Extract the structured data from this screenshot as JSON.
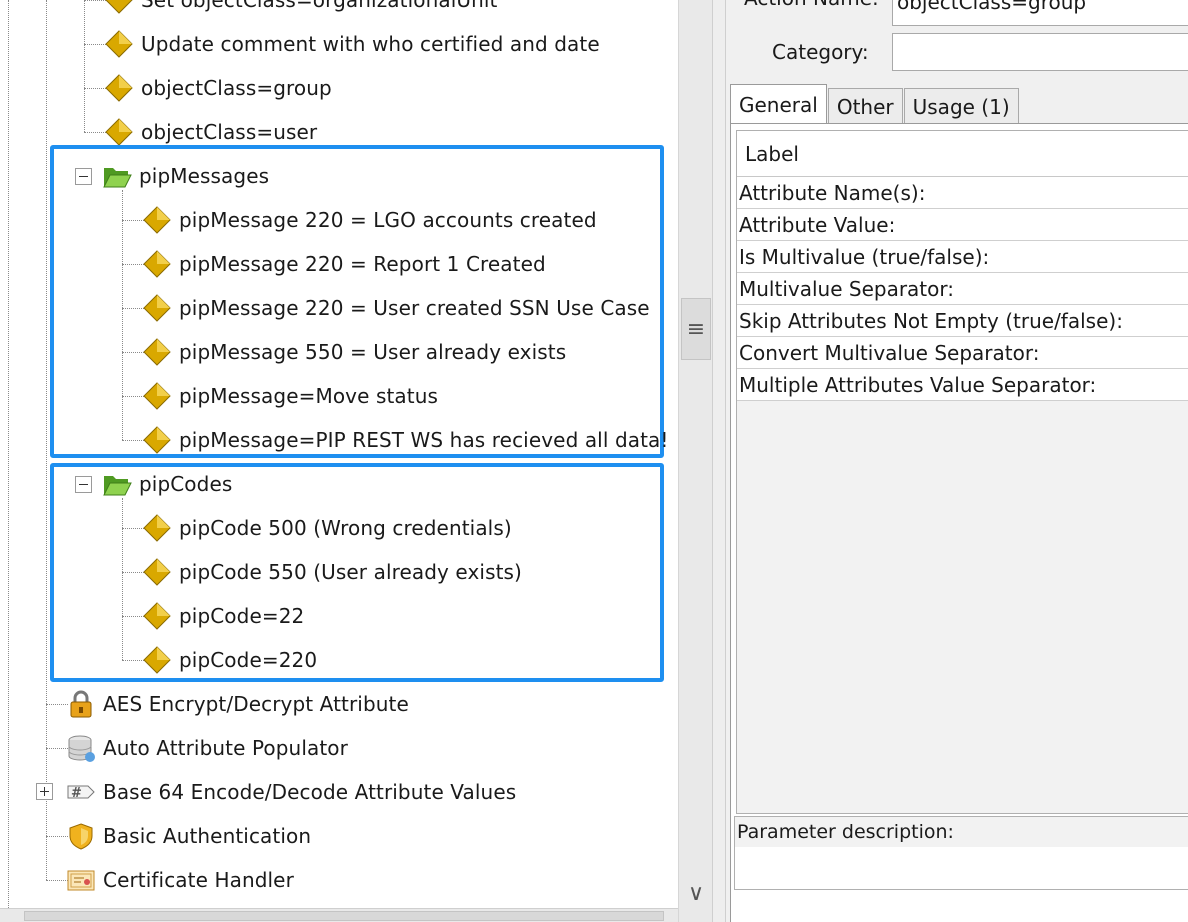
{
  "tree": {
    "top_items": [
      {
        "label": "Set objectClass=organizationalUnit",
        "icon": "action-diamond-icon"
      },
      {
        "label": "Update comment with who certified and date",
        "icon": "action-diamond-icon"
      },
      {
        "label": "objectClass=group",
        "icon": "action-diamond-icon"
      },
      {
        "label": "objectClass=user",
        "icon": "action-diamond-icon"
      }
    ],
    "pipMessages": {
      "label": "pipMessages",
      "items": [
        "pipMessage 220 = LGO accounts created",
        "pipMessage 220 = Report 1 Created",
        "pipMessage 220 = User created SSN Use Case",
        "pipMessage 550 = User already exists",
        "pipMessage=Move status",
        "pipMessage=PIP REST WS has recieved all data!"
      ]
    },
    "pipCodes": {
      "label": "pipCodes",
      "items": [
        "pipCode 500 (Wrong credentials)",
        "pipCode 550 (User already exists)",
        "pipCode=22",
        "pipCode=220"
      ]
    },
    "handlers": [
      {
        "label": "AES Encrypt/Decrypt Attribute",
        "icon": "lock-icon"
      },
      {
        "label": "Auto Attribute Populator",
        "icon": "database-icon"
      },
      {
        "label": "Base 64 Encode/Decode Attribute Values",
        "icon": "hash-tag-icon"
      },
      {
        "label": "Basic Authentication",
        "icon": "shield-icon"
      },
      {
        "label": "Certificate Handler",
        "icon": "certificate-icon"
      }
    ],
    "colors": {
      "highlight": "#1e8ff0",
      "folder": "#6fbf3a",
      "diamond": "#d9a800"
    }
  },
  "form": {
    "action_name_label": "Action Name:",
    "action_name_value": "objectClass=group",
    "category_label": "Category:",
    "category_value": ""
  },
  "tabs": [
    {
      "label": "General",
      "active": true
    },
    {
      "label": "Other",
      "active": false
    },
    {
      "label": "Usage (1)",
      "active": false
    }
  ],
  "params": {
    "header": "Label",
    "rows": [
      "Attribute Name(s):",
      "Attribute Value:",
      "Is Multivalue (true/false):",
      "Multivalue Separator:",
      "Skip Attributes Not Empty (true/false):",
      "Convert Multivalue Separator:",
      "Multiple Attributes Value Separator:"
    ],
    "description_label": "Parameter description:"
  },
  "scrollbar": {
    "thumb_glyph": "≡",
    "down_arrow_glyph": "∨"
  }
}
